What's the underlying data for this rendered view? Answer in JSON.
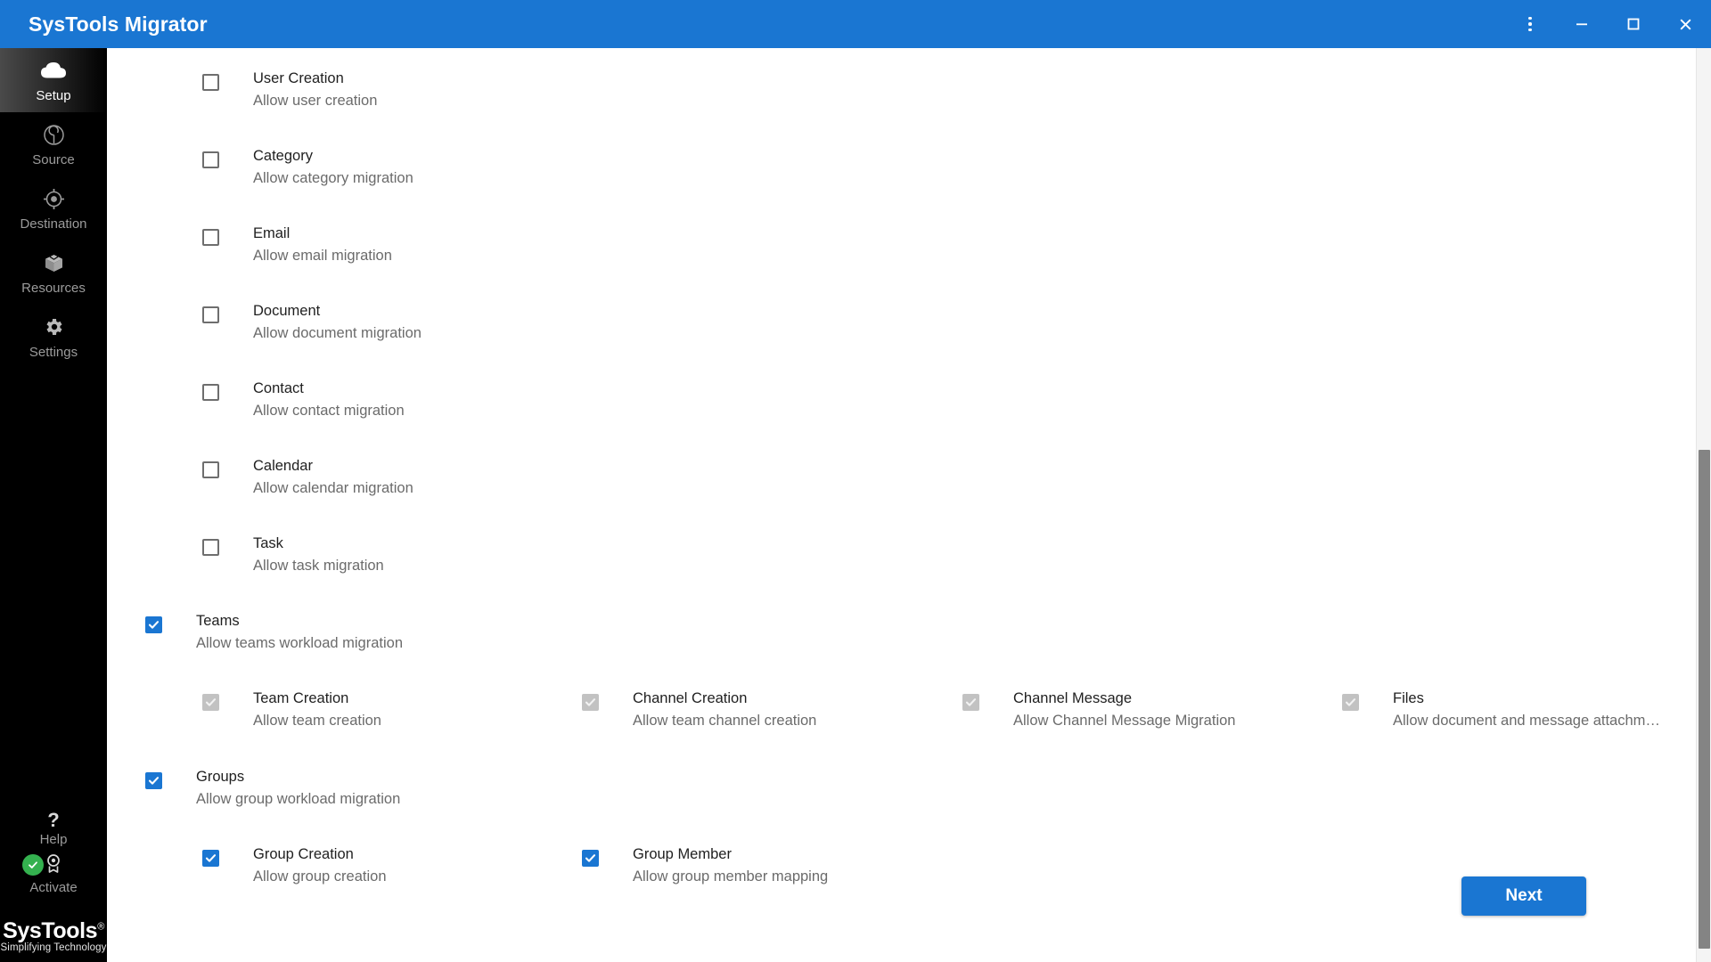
{
  "window": {
    "title": "SysTools Migrator",
    "accent_color": "#1a76d2",
    "controls": [
      {
        "name": "menu-button",
        "icon": "more-vertical-icon",
        "label": "More options"
      },
      {
        "name": "minimize-button",
        "icon": "minimize-icon",
        "label": "Minimize"
      },
      {
        "name": "maximize-button",
        "icon": "maximize-icon",
        "label": "Maximize"
      },
      {
        "name": "close-button",
        "icon": "close-icon",
        "label": "Close"
      }
    ]
  },
  "sidebar": {
    "items": [
      {
        "label": "Setup",
        "icon": "cloud-icon",
        "active": true
      },
      {
        "label": "Source",
        "icon": "source-radar-icon",
        "active": false
      },
      {
        "label": "Destination",
        "icon": "target-crosshair-icon",
        "active": false
      },
      {
        "label": "Resources",
        "icon": "box-icon",
        "active": false
      },
      {
        "label": "Settings",
        "icon": "gear-icon",
        "active": false
      }
    ],
    "help": {
      "label": "Help",
      "icon": "question-mark-icon"
    },
    "activate": {
      "label": "Activate",
      "icon": "badge-icon",
      "status_icon": "green-check-icon",
      "status_color": "#34b14f"
    },
    "logo": {
      "name": "SysTools",
      "registered": "®",
      "tagline": "Simplifying Technology"
    }
  },
  "main": {
    "workloads": [
      {
        "title": "User Creation",
        "subtitle": "Allow user creation",
        "state": "unchecked"
      },
      {
        "title": "Category",
        "subtitle": "Allow category migration",
        "state": "unchecked"
      },
      {
        "title": "Email",
        "subtitle": "Allow email migration",
        "state": "unchecked"
      },
      {
        "title": "Document",
        "subtitle": "Allow document migration",
        "state": "unchecked"
      },
      {
        "title": "Contact",
        "subtitle": "Allow contact migration",
        "state": "unchecked"
      },
      {
        "title": "Calendar",
        "subtitle": "Allow calendar migration",
        "state": "unchecked"
      },
      {
        "title": "Task",
        "subtitle": "Allow task migration",
        "state": "unchecked"
      }
    ],
    "teams": {
      "title": "Teams",
      "subtitle": "Allow teams workload migration",
      "state": "checked",
      "children": [
        {
          "title": "Team Creation",
          "subtitle": "Allow team creation",
          "state": "disabled-checked"
        },
        {
          "title": "Channel Creation",
          "subtitle": "Allow team channel creation",
          "state": "disabled-checked"
        },
        {
          "title": "Channel Message",
          "subtitle": "Allow Channel Message Migration",
          "state": "disabled-checked"
        },
        {
          "title": "Files",
          "subtitle": "Allow document and message attachmen…",
          "state": "disabled-checked"
        }
      ]
    },
    "groups": {
      "title": "Groups",
      "subtitle": "Allow group workload migration",
      "state": "checked",
      "children": [
        {
          "title": "Group Creation",
          "subtitle": "Allow group creation",
          "state": "checked"
        },
        {
          "title": "Group Member",
          "subtitle": "Allow group member mapping",
          "state": "checked"
        }
      ]
    },
    "next_button": "Next"
  }
}
